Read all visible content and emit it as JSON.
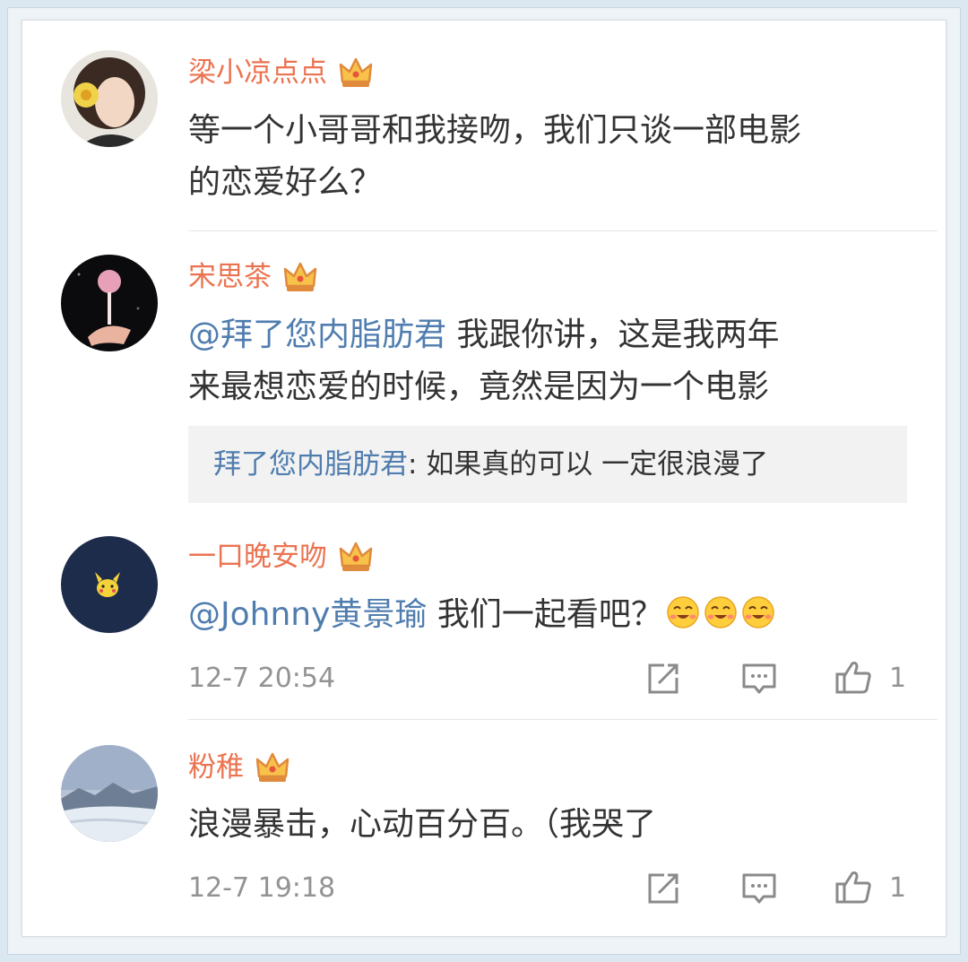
{
  "comments": [
    {
      "username": "梁小凉点点",
      "text_lines": [
        "等一个小哥哥和我接吻，我们只谈一部电影",
        "的恋爱好么？"
      ]
    },
    {
      "username": "宋思茶",
      "mention": "@拜了您内脂肪君",
      "text_line1": " 我跟你讲，这是我两年",
      "text_line2": "来最想恋爱的时候，竟然是因为一个电影",
      "quote": {
        "name": "拜了您内脂肪君",
        "separator": ": ",
        "text": "如果真的可以 一定很浪漫了"
      }
    },
    {
      "username": "一口晚安吻",
      "mention": "@Johnny黄景瑜",
      "text": " 我们一起看吧？",
      "emoji": "laughing-blush-emoji",
      "time": "12-7 20:54",
      "like_count": "1"
    },
    {
      "username": "粉稚",
      "text": "浪漫暴击，心动百分百。（我哭了",
      "time": "12-7 19:18",
      "like_count": "1"
    }
  ],
  "icons": {
    "badge": "crown-icon",
    "forward": "forward-icon",
    "comment": "comment-icon",
    "like": "thumbs-up-icon"
  },
  "colors": {
    "username": "#eb7350",
    "mention": "#507daf",
    "text": "#333333",
    "meta": "#939393",
    "quote_bg": "#f2f2f2"
  }
}
